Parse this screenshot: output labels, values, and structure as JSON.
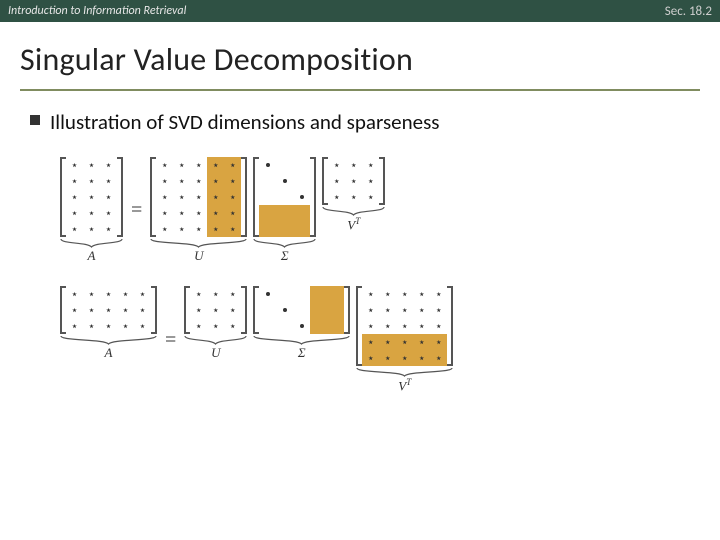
{
  "topbar": {
    "left": "Introduction to Information Retrieval",
    "right": "Sec. 18.2"
  },
  "title": "Singular Value Decomposition",
  "bullet": "Illustration of SVD dimensions and sparseness",
  "glyphs": {
    "star": "⋆",
    "eq": "="
  },
  "labels": {
    "A": "A",
    "U": "U",
    "Sigma": "Σ",
    "VT_base": "V",
    "VT_sup": "T"
  },
  "chart_data": [
    {
      "type": "table",
      "title": "SVD tall case (M>N)",
      "equation": "A = U Σ Vᵀ",
      "dims": {
        "M": 5,
        "N": 3
      },
      "matrices": {
        "A": {
          "rows": 5,
          "cols": 3,
          "fill": "dense-star"
        },
        "U": {
          "rows": 5,
          "cols": 5,
          "fill": "dense-star",
          "highlight_cols": [
            3,
            4
          ]
        },
        "Sigma": {
          "rows": 5,
          "cols": 3,
          "fill": "diagonal-dot",
          "highlight_rows": [
            3,
            4
          ]
        },
        "VT": {
          "rows": 3,
          "cols": 3,
          "fill": "dense-star"
        }
      }
    },
    {
      "type": "table",
      "title": "SVD wide case (M<N)",
      "equation": "A = U Σ Vᵀ",
      "dims": {
        "M": 3,
        "N": 5
      },
      "matrices": {
        "A": {
          "rows": 3,
          "cols": 5,
          "fill": "dense-star"
        },
        "U": {
          "rows": 3,
          "cols": 3,
          "fill": "dense-star"
        },
        "Sigma": {
          "rows": 3,
          "cols": 5,
          "fill": "diagonal-dot",
          "highlight_cols": [
            3,
            4
          ]
        },
        "VT": {
          "rows": 5,
          "cols": 5,
          "fill": "dense-star",
          "highlight_rows": [
            3,
            4
          ]
        }
      }
    }
  ]
}
